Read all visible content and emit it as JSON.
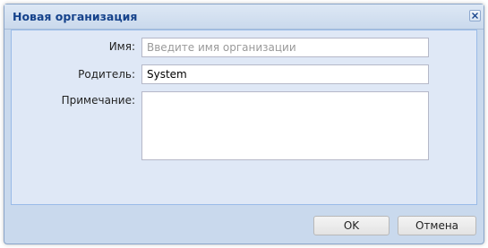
{
  "dialog": {
    "title": "Новая организация",
    "close_icon": "close-icon"
  },
  "form": {
    "name_label": "Имя:",
    "name_placeholder": "Введите имя организации",
    "name_value": "",
    "parent_label": "Родитель:",
    "parent_value": "System",
    "note_label": "Примечание:",
    "note_value": ""
  },
  "buttons": {
    "ok_label": "OK",
    "cancel_label": "Отмена"
  },
  "colors": {
    "title_text": "#15428b",
    "frame": "#c9d9ed",
    "panel": "#dfe8f6"
  }
}
